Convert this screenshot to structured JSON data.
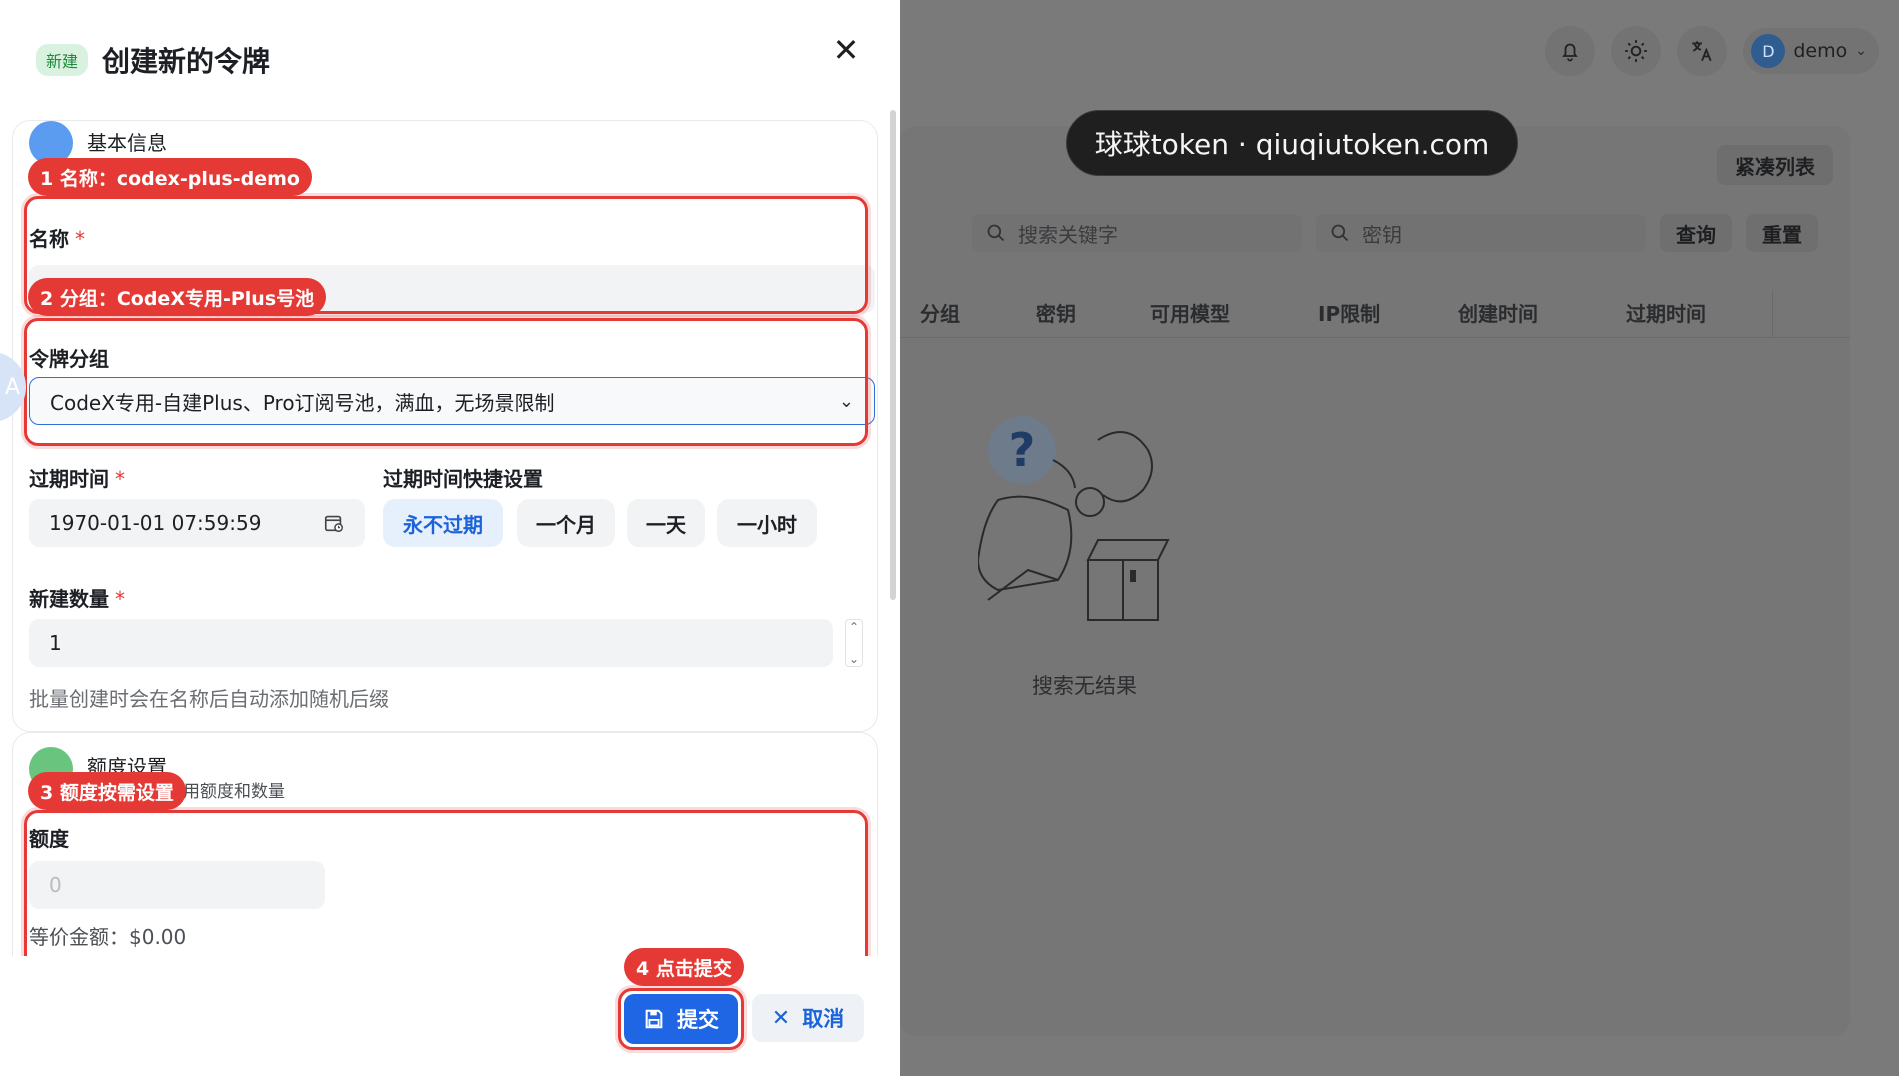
{
  "background": {
    "compact_list": "紧凑列表",
    "watermark": "球球token · qiuqiutoken.com",
    "search_keyword_placeholder": "搜索关键字",
    "search_key_placeholder": "密钥",
    "query_button": "查询",
    "reset_button": "重置",
    "columns": [
      "分组",
      "密钥",
      "可用模型",
      "IP限制",
      "创建时间",
      "过期时间"
    ],
    "empty_text": "搜索无结果",
    "user": {
      "initial": "D",
      "name": "demo"
    }
  },
  "drawer": {
    "tag": "新建",
    "title": "创建新的令牌",
    "section_basic": {
      "title": "基本信息"
    },
    "section_quota": {
      "title": "额度设置",
      "subtitle": "用额度和数量"
    },
    "name_label": "名称",
    "group_label": "令牌分组",
    "group_value": "CodeX专用-自建Plus、Pro订阅号池，满血，无场景限制",
    "expire_label": "过期时间",
    "expire_value": "1970-01-01 07:59:59",
    "quick_label": "过期时间快捷设置",
    "quick_buttons": [
      "永不过期",
      "一个月",
      "一天",
      "一小时"
    ],
    "count_label": "新建数量",
    "count_value": "1",
    "count_hint": "批量创建时会在名称后自动添加随机后缀",
    "quota_label": "额度",
    "quota_placeholder": "0",
    "equiv_amount": "等价金额：$0.00",
    "submit": "提交",
    "cancel": "取消"
  },
  "annotations": {
    "step1": "1 名称：codex-plus-demo",
    "step2": "2 分组：CodeX专用-Plus号池",
    "step3": "3 额度按需设置",
    "step4": "4 点击提交"
  },
  "colors": {
    "accent": "#1f66e5",
    "annotation": "#e53935",
    "required": "#e53935"
  }
}
